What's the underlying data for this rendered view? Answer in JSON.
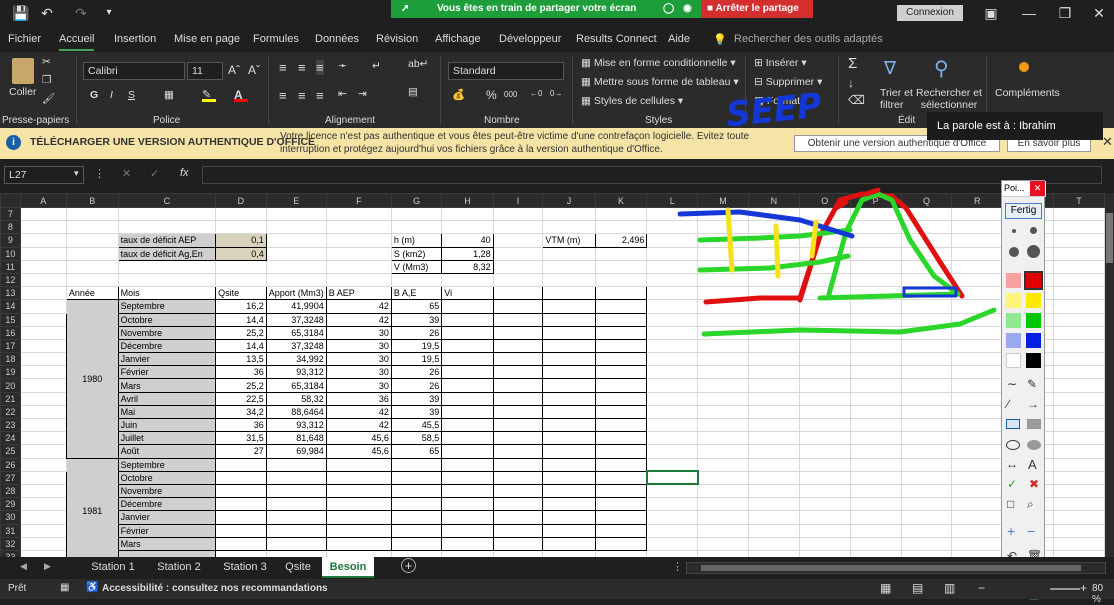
{
  "titlebar": {
    "share_message": "Vous êtes en train de partager votre écran",
    "stop_share": "Arrêter le partage",
    "connexion": "Connexion"
  },
  "menu": [
    "Fichier",
    "Accueil",
    "Insertion",
    "Mise en page",
    "Formules",
    "Données",
    "Révision",
    "Affichage",
    "Développeur",
    "Results Connect",
    "Aide"
  ],
  "search_placeholder": "Rechercher des outils adaptés",
  "ribbon": {
    "coller": "Coller",
    "font_name": "Calibri",
    "font_size": "11",
    "number_format": "Standard",
    "cond_format": "Mise en forme conditionnelle",
    "table_format": "Mettre sous forme de tableau",
    "cell_styles": "Styles de cellules",
    "insert": "Insérer",
    "delete": "Supprimer",
    "format": "Format",
    "sort_filter": "Trier et filtrer",
    "find_select": "Rechercher et sélectionner",
    "complements": "Compléments",
    "groups": [
      "Presse-papiers",
      "Police",
      "Alignement",
      "Nombre",
      "Styles",
      "Édit"
    ]
  },
  "notice": {
    "title": "TÉLÉCHARGER UNE VERSION AUTHENTIQUE D'OFFICE",
    "line1": "Votre licence n'est pas authentique et vous êtes peut-être victime d'une contrefaçon logicielle. Evitez toute",
    "line2": "interruption et protégez aujourd'hui vos fichiers grâce à la version authentique d'Office.",
    "btn1": "Obtenir une version authentique d'Office",
    "btn2": "En savoir plus"
  },
  "parole": "La parole est à : Ibrahim",
  "formula_bar": {
    "cell_ref": "L27",
    "fx": "fx"
  },
  "columns": [
    "A",
    "B",
    "C",
    "D",
    "E",
    "F",
    "G",
    "H",
    "I",
    "J",
    "K",
    "L",
    "M",
    "N",
    "O",
    "P",
    "Q",
    "R",
    "S",
    "T"
  ],
  "params": [
    {
      "label": "taux de déficit AEP",
      "value": "0,1"
    },
    {
      "label": "taux de déficit Ag,En",
      "value": "0,4"
    }
  ],
  "reservoir": [
    {
      "label": "h (m)",
      "value": "40"
    },
    {
      "label": "S (km2)",
      "value": "1,28"
    },
    {
      "label": "V (Mm3)",
      "value": "8,32"
    }
  ],
  "vtm": {
    "label": "VTM (m)",
    "value": "2,496"
  },
  "headers": [
    "Année",
    "Mois",
    "Qsite",
    "Apport (Mm3)",
    "B AEP",
    "B A,E",
    "Vi"
  ],
  "year1980": "1980",
  "year1981": "1981",
  "rows1980": [
    [
      "Septembre",
      "16,2",
      "41,9904",
      "42",
      "65"
    ],
    [
      "Octobre",
      "14,4",
      "37,3248",
      "42",
      "39"
    ],
    [
      "Novembre",
      "25,2",
      "65,3184",
      "30",
      "26"
    ],
    [
      "Décembre",
      "14,4",
      "37,3248",
      "30",
      "19,5"
    ],
    [
      "Janvier",
      "13,5",
      "34,992",
      "30",
      "19,5"
    ],
    [
      "Février",
      "36",
      "93,312",
      "30",
      "26"
    ],
    [
      "Mars",
      "25,2",
      "65,3184",
      "30",
      "26"
    ],
    [
      "Avril",
      "22,5",
      "58,32",
      "36",
      "39"
    ],
    [
      "Mai",
      "34,2",
      "88,6464",
      "42",
      "39"
    ],
    [
      "Juin",
      "36",
      "93,312",
      "42",
      "45,5"
    ],
    [
      "Juillet",
      "31,5",
      "81,648",
      "45,6",
      "58,5"
    ],
    [
      "Août",
      "27",
      "69,984",
      "45,6",
      "65"
    ]
  ],
  "months1981": [
    "Septembre",
    "Octobre",
    "Novembre",
    "Décembre",
    "Janvier",
    "Février",
    "Mars"
  ],
  "sheets": [
    "Station 1",
    "Station 2",
    "Station 3",
    "Qsite",
    "Besoin"
  ],
  "active_sheet": "Besoin",
  "status": {
    "ready": "Prêt",
    "accessibility": "Accessibilité : consultez nos recommandations",
    "zoom": "80 %"
  },
  "pen_panel": {
    "title": "Poi...",
    "fertig": "Fertig"
  },
  "annotation_text": "SEEP"
}
